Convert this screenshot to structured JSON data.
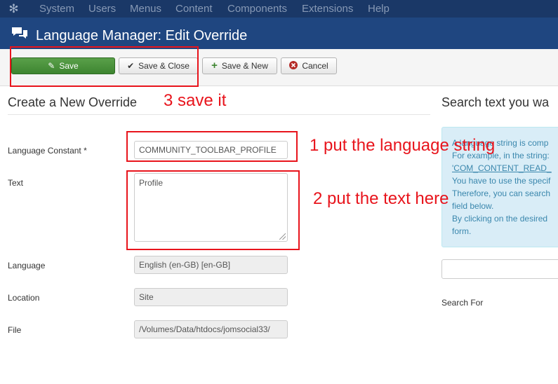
{
  "top_menu": [
    "System",
    "Users",
    "Menus",
    "Content",
    "Components",
    "Extensions",
    "Help"
  ],
  "header": {
    "title": "Language Manager: Edit Override"
  },
  "toolbar": {
    "save_label": "Save",
    "save_close_label": "Save & Close",
    "save_new_label": "Save & New",
    "cancel_label": "Cancel"
  },
  "form": {
    "heading": "Create a New Override",
    "constant_label": "Language Constant *",
    "constant_value": "COMMUNITY_TOOLBAR_PROFILE",
    "text_label": "Text",
    "text_value": "Profile",
    "language_label": "Language",
    "language_value": "English (en-GB) [en-GB]",
    "location_label": "Location",
    "location_value": "Site",
    "file_label": "File",
    "file_value": "/Volumes/Data/htdocs/jomsocial33/"
  },
  "search_panel": {
    "heading": "Search text you wa",
    "info_lines": [
      "A language string is comp",
      "For example, in the string:",
      "'COM_CONTENT_READ_",
      "You have to use the specif",
      "Therefore, you can search",
      "field below.",
      "By clicking on the desired",
      "form."
    ],
    "search_for_label": "Search For"
  },
  "annotations": {
    "step1": "1 put the language string",
    "step2": "2 put the text here",
    "step3": "3 save it",
    "color": "#e8141c"
  },
  "colors": {
    "topbar": "#1a3867",
    "titlebar": "#1f4680",
    "save": "#3d8530",
    "info_bg": "#d9edf7"
  }
}
